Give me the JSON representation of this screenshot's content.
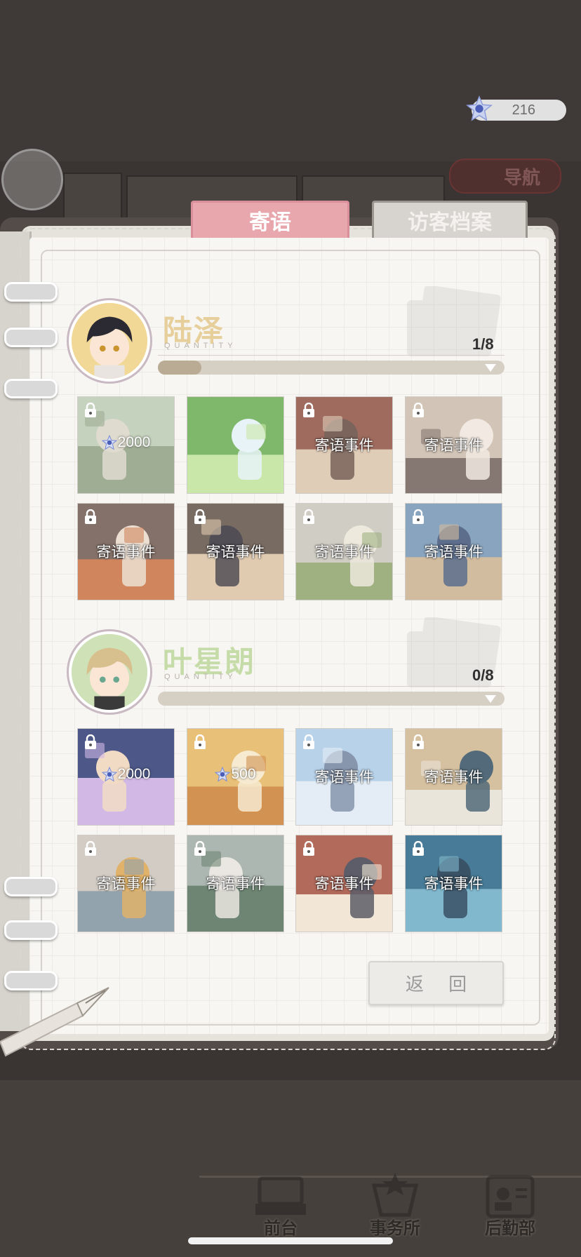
{
  "currency": {
    "amount": "216",
    "icon": "star-crystal-icon"
  },
  "nav_button": {
    "label": "导航"
  },
  "tabs": [
    {
      "label": "寄语",
      "active": true
    },
    {
      "label": "访客档案",
      "active": false
    }
  ],
  "characters": [
    {
      "name": "陆泽",
      "sub": "QUANTITY",
      "count": "1/8",
      "progress": 0.125,
      "name_color": "#e6cf9b",
      "cards": [
        {
          "type": "cost",
          "cost": "2000",
          "locked": true
        },
        {
          "type": "unlocked",
          "locked": false
        },
        {
          "type": "event",
          "label": "寄语事件",
          "locked": true
        },
        {
          "type": "event",
          "label": "寄语事件",
          "locked": true
        },
        {
          "type": "event",
          "label": "寄语事件",
          "locked": true
        },
        {
          "type": "event",
          "label": "寄语事件",
          "locked": true
        },
        {
          "type": "event",
          "label": "寄语事件",
          "locked": true
        },
        {
          "type": "event",
          "label": "寄语事件",
          "locked": true
        }
      ]
    },
    {
      "name": "叶星朗",
      "sub": "QUANTITY",
      "count": "0/8",
      "progress": 0,
      "name_color": "#c6dca8",
      "cards": [
        {
          "type": "cost",
          "cost": "2000",
          "locked": true
        },
        {
          "type": "cost",
          "cost": "500",
          "locked": true
        },
        {
          "type": "event",
          "label": "寄语事件",
          "locked": true
        },
        {
          "type": "event",
          "label": "寄语事件",
          "locked": true
        },
        {
          "type": "event",
          "label": "寄语事件",
          "locked": true
        },
        {
          "type": "event",
          "label": "寄语事件",
          "locked": true
        },
        {
          "type": "event",
          "label": "寄语事件",
          "locked": true
        },
        {
          "type": "event",
          "label": "寄语事件",
          "locked": true
        }
      ]
    }
  ],
  "return_button": {
    "label": "返 回"
  },
  "bottom_nav": [
    {
      "label": "前台",
      "icon": "reception-icon"
    },
    {
      "label": "事务所",
      "icon": "office-icon"
    },
    {
      "label": "后勤部",
      "icon": "logistics-icon"
    }
  ],
  "colors": {
    "tab_active": "#e8a7ad",
    "tab_inactive": "#d7d3ce",
    "progress": "#b9ab94"
  }
}
